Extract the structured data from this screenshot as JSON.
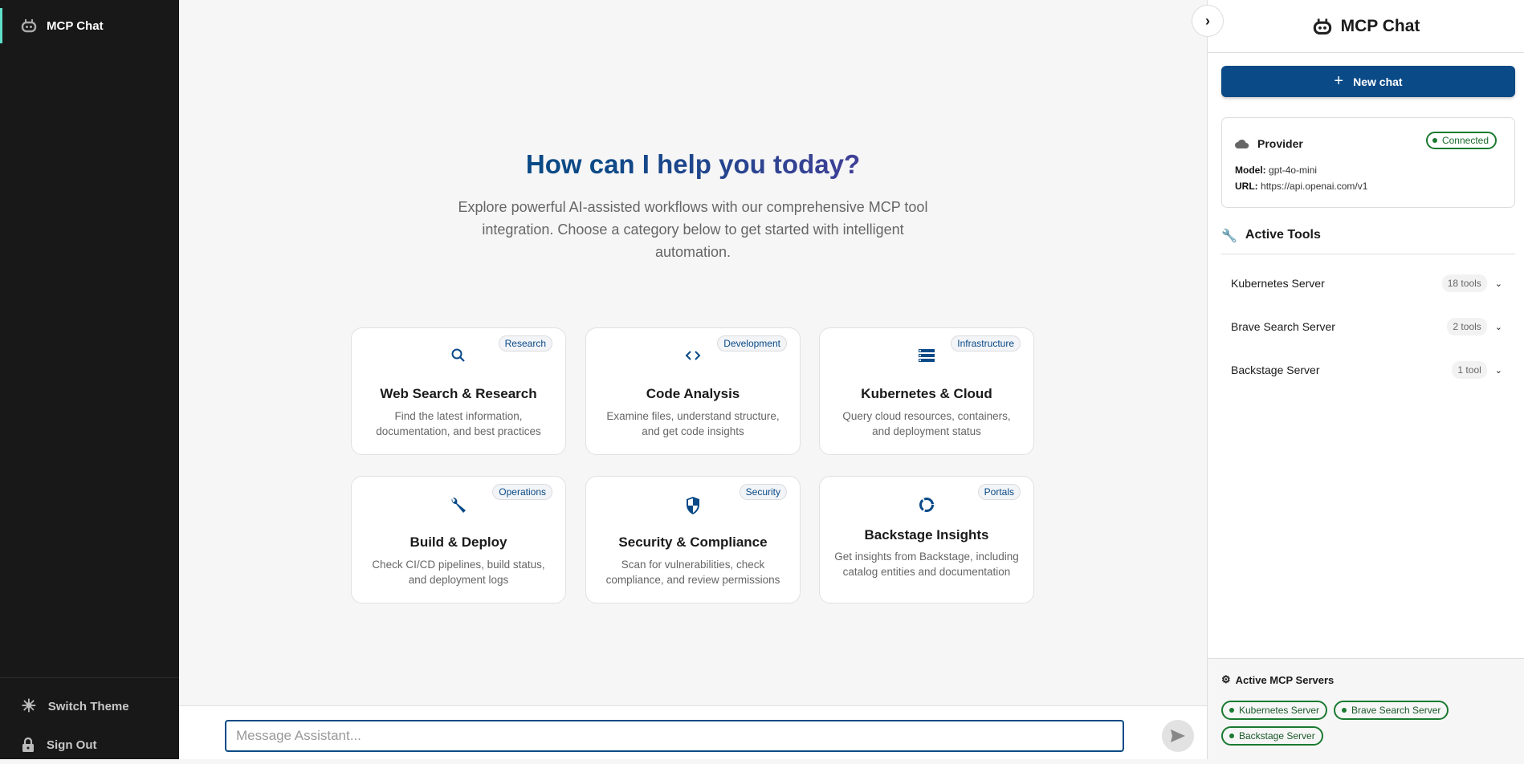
{
  "sidebar": {
    "app_label": "MCP Chat",
    "switch_theme": "Switch Theme",
    "sign_out": "Sign Out"
  },
  "main": {
    "title": "How can I help you today?",
    "subtitle": "Explore powerful AI-assisted workflows with our comprehensive MCP tool integration. Choose a category below to get started with intelligent automation.",
    "cards": [
      {
        "tag": "Research",
        "title": "Web Search & Research",
        "desc": "Find the latest information, documentation, and best practices",
        "icon": "search-icon"
      },
      {
        "tag": "Development",
        "title": "Code Analysis",
        "desc": "Examine files, understand structure, and get code insights",
        "icon": "code-icon"
      },
      {
        "tag": "Infrastructure",
        "title": "Kubernetes & Cloud",
        "desc": "Query cloud resources, containers, and deployment status",
        "icon": "storage-icon"
      },
      {
        "tag": "Operations",
        "title": "Build & Deploy",
        "desc": "Check CI/CD pipelines, build status, and deployment logs",
        "icon": "wrench-icon"
      },
      {
        "tag": "Security",
        "title": "Security & Compliance",
        "desc": "Scan for vulnerabilities, check compliance, and review permissions",
        "icon": "shield-icon"
      },
      {
        "tag": "Portals",
        "title": "Backstage Insights",
        "desc": "Get insights from Backstage, including catalog entities and documentation",
        "icon": "backstage-icon"
      }
    ],
    "input_placeholder": "Message Assistant..."
  },
  "panel": {
    "title": "MCP Chat",
    "new_chat": "New chat",
    "provider": {
      "label": "Provider",
      "status": "Connected",
      "model_label": "Model:",
      "model": "gpt-4o-mini",
      "url_label": "URL:",
      "url": "https://api.openai.com/v1"
    },
    "active_tools": "Active Tools",
    "tools": [
      {
        "name": "Kubernetes Server",
        "count": "18 tools"
      },
      {
        "name": "Brave Search Server",
        "count": "2 tools"
      },
      {
        "name": "Backstage Server",
        "count": "1 tool"
      }
    ],
    "active_servers_label": "Active MCP Servers",
    "servers": [
      "Kubernetes Server",
      "Brave Search Server",
      "Backstage Server"
    ]
  },
  "colors": {
    "primary": "#0a4a87",
    "success": "#1a7a30",
    "sidebar_bg": "#181818"
  }
}
